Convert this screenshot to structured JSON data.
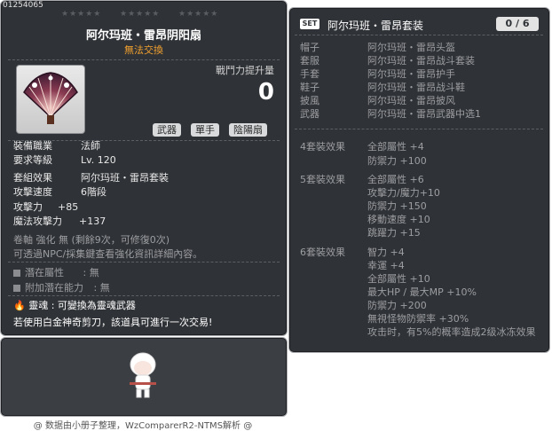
{
  "item": {
    "id": "01254065",
    "stars": [
      "★★★★★",
      "★★★★★",
      "★★★★★"
    ],
    "name": "阿尔玛班・雷昂阴阳扇",
    "untradeable": "無法交換",
    "combat_power_label": "戰鬥力提升量",
    "combat_power_value": "0",
    "tags": [
      "武器",
      "單手",
      "陰陽扇"
    ],
    "job_label": "裝備職業",
    "job_value": "法師",
    "level_label": "要求等級",
    "level_value": "Lv. 120",
    "set_label": "套組效果",
    "set_value": "阿尔玛班・雷昂套裝",
    "speed_label": "攻擊速度",
    "speed_value": "6階段",
    "atk_label": "攻擊力",
    "atk_value": "+85",
    "matk_label": "魔法攻擊力",
    "matk_value": "+137",
    "scroll_line": "卷軸 強化 無 (剩餘9次，可修復0次)",
    "npc_line": "可透過NPC/採集鍵查看強化資訊詳細內容。",
    "potential_label": "潛在屬性",
    "potential_value": ": 無",
    "add_potential_label": "附加潛在能力",
    "add_potential_value": ": 無",
    "soul_line": "靈魂 : 可變換為靈魂武器",
    "scissors_line": "若使用白金神奇剪刀，該道具可進行一次交易!"
  },
  "set": {
    "badge": "SET",
    "name": "阿尔玛班・雷昂套装",
    "count": "0 / 6",
    "parts": [
      {
        "slot": "帽子",
        "item": "阿尔玛班・雷昂头盔"
      },
      {
        "slot": "套服",
        "item": "阿尔玛班・雷昂战斗套装"
      },
      {
        "slot": "手套",
        "item": "阿尔玛班・雷昂护手"
      },
      {
        "slot": "鞋子",
        "item": "阿尔玛班・雷昂战斗鞋"
      },
      {
        "slot": "披風",
        "item": "阿尔玛班・雷昂披风"
      },
      {
        "slot": "武器",
        "item": "阿尔玛班・雷昂武器中选1"
      }
    ],
    "effect4_label": "4套裝效果",
    "effect4": [
      "全部屬性 +4",
      "防禦力 +100"
    ],
    "effect5_label": "5套裝效果",
    "effect5": [
      "全部屬性 +6",
      "攻擊力/魔力+10",
      "防禦力 +150",
      "移動速度 +10",
      "跳躍力 +15"
    ],
    "effect6_label": "6套裝效果",
    "effect6": [
      "智力 +4",
      "幸運 +4",
      "全部屬性 +10",
      "最大HP / 最大MP +10%",
      "防禦力 +200",
      "無視怪物防禦率 +30%",
      "攻击时，有5%的概率造成2级冰冻效果"
    ]
  },
  "footer": "@ 数据由小册子整理，WzComparerR2-NTMS解析 @",
  "colors": {
    "panel": "#2f3236",
    "untradeable": "#f0a030",
    "text": "#e8e8e8",
    "muted": "#9c9ea2"
  }
}
